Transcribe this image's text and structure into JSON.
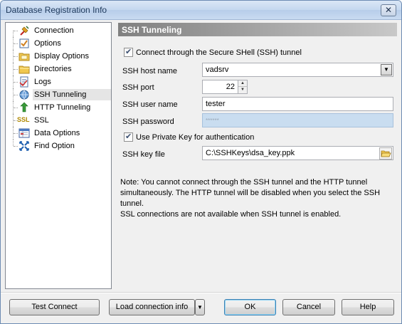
{
  "window": {
    "title": "Database Registration Info",
    "close_glyph": "✕"
  },
  "tree": {
    "items": [
      {
        "label": "Connection",
        "icon": "connection-plug-icon"
      },
      {
        "label": "Options",
        "icon": "checkbox-options-icon"
      },
      {
        "label": "Display Options",
        "icon": "folder-display-icon"
      },
      {
        "label": "Directories",
        "icon": "folder-directories-icon"
      },
      {
        "label": "Logs",
        "icon": "logs-icon"
      },
      {
        "label": "SSH Tunneling",
        "icon": "ssh-tunnel-icon"
      },
      {
        "label": "HTTP Tunneling",
        "icon": "http-tunnel-icon"
      },
      {
        "label": "SSL",
        "icon": "ssl-icon"
      },
      {
        "label": "Data Options",
        "icon": "data-options-icon"
      },
      {
        "label": "Find Option",
        "icon": "find-option-icon"
      }
    ],
    "selected": "SSH Tunneling",
    "ssl_icon_text": "SSL"
  },
  "content": {
    "section_title": "SSH Tunneling",
    "connect_ssh_label": "Connect through the Secure SHell (SSH) tunnel",
    "connect_ssh_checked": true,
    "host_label": "SSH host name",
    "host_value": "vadsrv",
    "port_label": "SSH port",
    "port_value": "22",
    "user_label": "SSH user name",
    "user_value": "tester",
    "password_label": "SSH password",
    "password_value": "******",
    "private_key_label": "Use Private Key for authentication",
    "private_key_checked": true,
    "key_file_label": "SSH key file",
    "key_file_value": "C:\\SSHKeys\\dsa_key.ppk",
    "note_line1": "Note: You cannot connect through the SSH tunnel and the HTTP tunnel simultaneously. The HTTP tunnel will be disabled  when you select the SSH tunnel.",
    "note_line2": "SSL connections are not available when SSH tunnel is enabled."
  },
  "buttons": {
    "test_connect": "Test Connect",
    "load_connection_info": "Load connection info",
    "ok": "OK",
    "cancel": "Cancel",
    "help": "Help"
  }
}
